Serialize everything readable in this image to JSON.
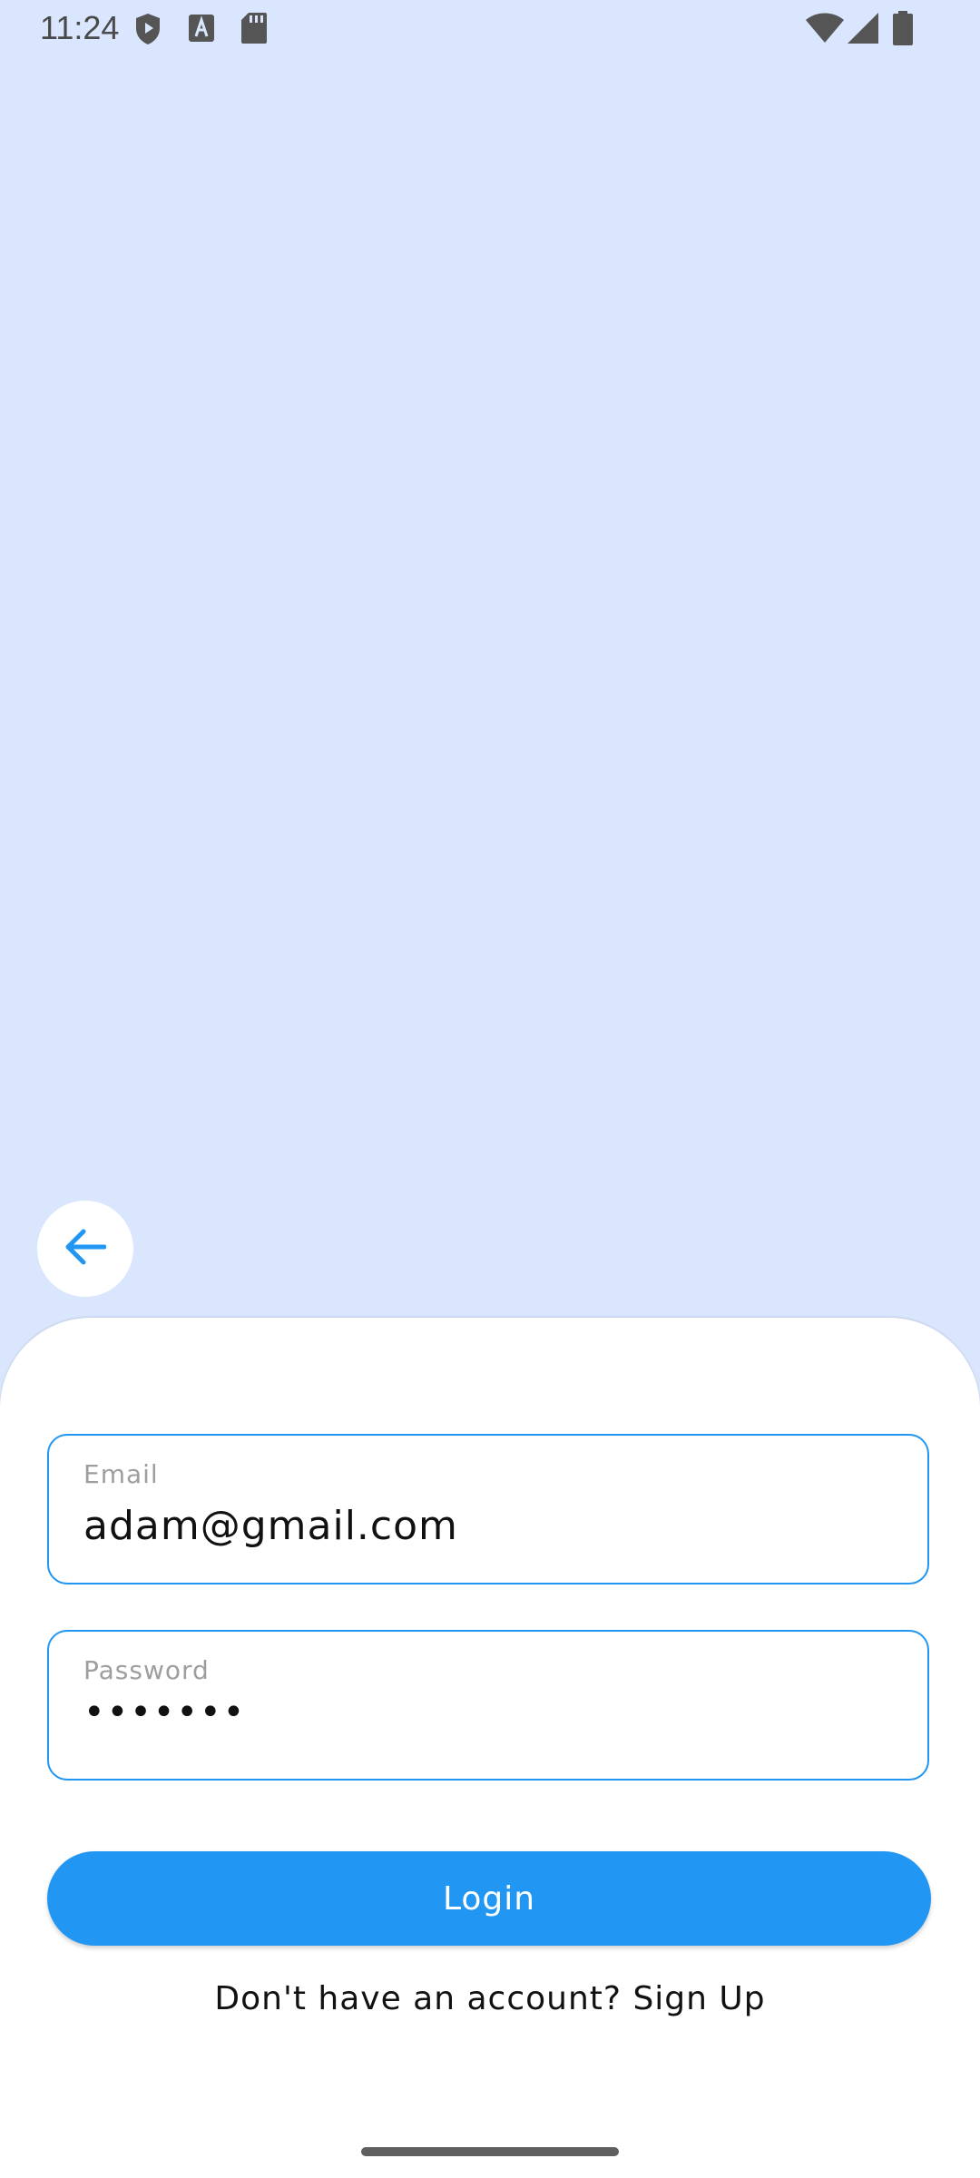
{
  "status_bar": {
    "time": "11:24",
    "icons": [
      "shield-icon",
      "font-a-icon",
      "sd-card-icon",
      "wifi-icon",
      "signal-icon",
      "battery-icon"
    ]
  },
  "colors": {
    "background": "#d9e6fd",
    "accent": "#2196f3",
    "sheet": "#ffffff"
  },
  "back_button": {
    "icon": "arrow-left-icon"
  },
  "form": {
    "email": {
      "label": "Email",
      "value": "adam@gmail.com"
    },
    "password": {
      "label": "Password",
      "value": "•••••••"
    },
    "login_label": "Login",
    "signup_text": "Don't have an account? Sign Up"
  }
}
